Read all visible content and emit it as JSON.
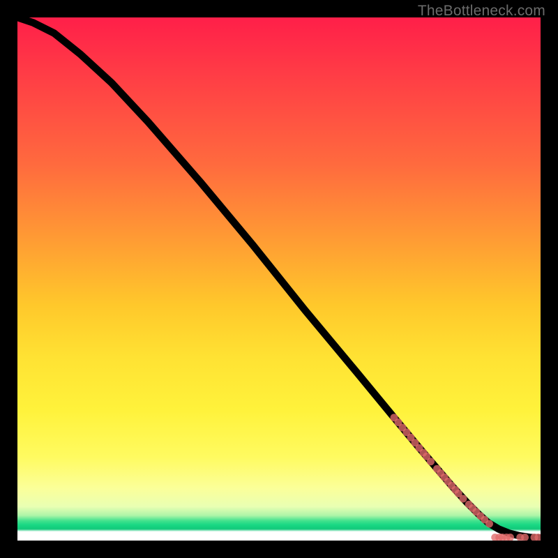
{
  "watermark": "TheBottleneck.com",
  "colors": {
    "background": "#000000",
    "marker": "#e06a6a",
    "curve": "#000000",
    "gradient_top": "#ff1f49",
    "gradient_mid": "#ffe233",
    "gradient_green": "#19d884"
  },
  "chart_data": {
    "type": "line",
    "title": "",
    "xlabel": "",
    "ylabel": "",
    "xlim": [
      0,
      100
    ],
    "ylim": [
      0,
      100
    ],
    "grid": false,
    "legend": false,
    "curve": [
      {
        "x": 0,
        "y": 100
      },
      {
        "x": 3,
        "y": 99
      },
      {
        "x": 7,
        "y": 97
      },
      {
        "x": 12,
        "y": 93
      },
      {
        "x": 18,
        "y": 87.5
      },
      {
        "x": 25,
        "y": 80
      },
      {
        "x": 35,
        "y": 68.5
      },
      {
        "x": 45,
        "y": 56.5
      },
      {
        "x": 55,
        "y": 44
      },
      {
        "x": 65,
        "y": 32
      },
      {
        "x": 72,
        "y": 23.5
      },
      {
        "x": 77,
        "y": 17.5
      },
      {
        "x": 80,
        "y": 14
      },
      {
        "x": 83,
        "y": 10.5
      },
      {
        "x": 86,
        "y": 7.2
      },
      {
        "x": 88,
        "y": 5.2
      },
      {
        "x": 90,
        "y": 3.4
      },
      {
        "x": 92,
        "y": 2.2
      },
      {
        "x": 94,
        "y": 1.4
      },
      {
        "x": 96,
        "y": 0.9
      },
      {
        "x": 98,
        "y": 0.6
      },
      {
        "x": 100,
        "y": 0.5
      }
    ],
    "marker_points": [
      {
        "x": 72.0,
        "y": 23.5
      },
      {
        "x": 72.8,
        "y": 22.6
      },
      {
        "x": 73.6,
        "y": 21.6
      },
      {
        "x": 74.4,
        "y": 20.7
      },
      {
        "x": 75.2,
        "y": 19.7
      },
      {
        "x": 76.0,
        "y": 18.7
      },
      {
        "x": 76.8,
        "y": 17.7
      },
      {
        "x": 77.6,
        "y": 16.8
      },
      {
        "x": 78.2,
        "y": 16.1
      },
      {
        "x": 79.0,
        "y": 15.1
      },
      {
        "x": 80.2,
        "y": 13.7
      },
      {
        "x": 80.9,
        "y": 12.9
      },
      {
        "x": 81.6,
        "y": 12.1
      },
      {
        "x": 82.3,
        "y": 11.3
      },
      {
        "x": 83.0,
        "y": 10.5
      },
      {
        "x": 83.7,
        "y": 9.7
      },
      {
        "x": 84.3,
        "y": 9.0
      },
      {
        "x": 85.2,
        "y": 8.0
      },
      {
        "x": 86.3,
        "y": 6.9
      },
      {
        "x": 87.0,
        "y": 6.2
      },
      {
        "x": 87.7,
        "y": 5.5
      },
      {
        "x": 88.5,
        "y": 4.7
      },
      {
        "x": 89.3,
        "y": 4.0
      },
      {
        "x": 90.2,
        "y": 3.2
      },
      {
        "x": 91.3,
        "y": 0.6
      },
      {
        "x": 92.1,
        "y": 0.6
      },
      {
        "x": 92.7,
        "y": 0.6
      },
      {
        "x": 93.5,
        "y": 0.6
      },
      {
        "x": 94.2,
        "y": 0.6
      },
      {
        "x": 96.1,
        "y": 0.6
      },
      {
        "x": 97.0,
        "y": 0.6
      },
      {
        "x": 98.8,
        "y": 0.6
      },
      {
        "x": 99.6,
        "y": 0.6
      }
    ],
    "marker_radius": 5.5
  }
}
